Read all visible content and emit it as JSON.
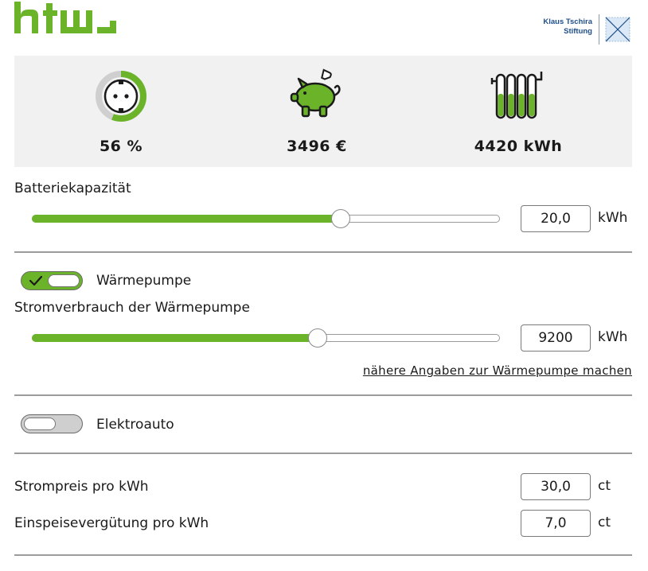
{
  "header": {
    "logo_text": "htw",
    "partner_logo": {
      "line1": "Klaus Tschira",
      "line2": "Stiftung"
    }
  },
  "summary": {
    "autarky": {
      "value": "56 %",
      "fraction": 0.56,
      "icon": "power-socket-icon"
    },
    "savings": {
      "value": "3496 €",
      "icon": "piggy-bank-icon"
    },
    "heating": {
      "value": "4420 kWh",
      "icon": "radiator-icon"
    }
  },
  "battery": {
    "label": "Batteriekapazität",
    "value": "20,0",
    "unit": "kWh",
    "slider_fraction": 0.66
  },
  "heat_pump": {
    "toggle_label": "Wärmepumpe",
    "enabled": true,
    "consumption_label": "Stromverbrauch der Wärmepumpe",
    "value": "9200",
    "unit": "kWh",
    "slider_fraction": 0.61,
    "details_link": "nähere Angaben zur Wärmepumpe machen"
  },
  "electric_car": {
    "toggle_label": "Elektroauto",
    "enabled": false
  },
  "prices": {
    "electricity_label": "Strompreis pro kWh",
    "electricity_value": "30,0",
    "electricity_unit": "ct",
    "feedin_label": "Einspeisevergütung pro kWh",
    "feedin_value": "7,0",
    "feedin_unit": "ct"
  },
  "colors": {
    "accent": "#6bb42a",
    "panel": "#f1f1f1",
    "toggle_off": "#cfcfcf"
  }
}
